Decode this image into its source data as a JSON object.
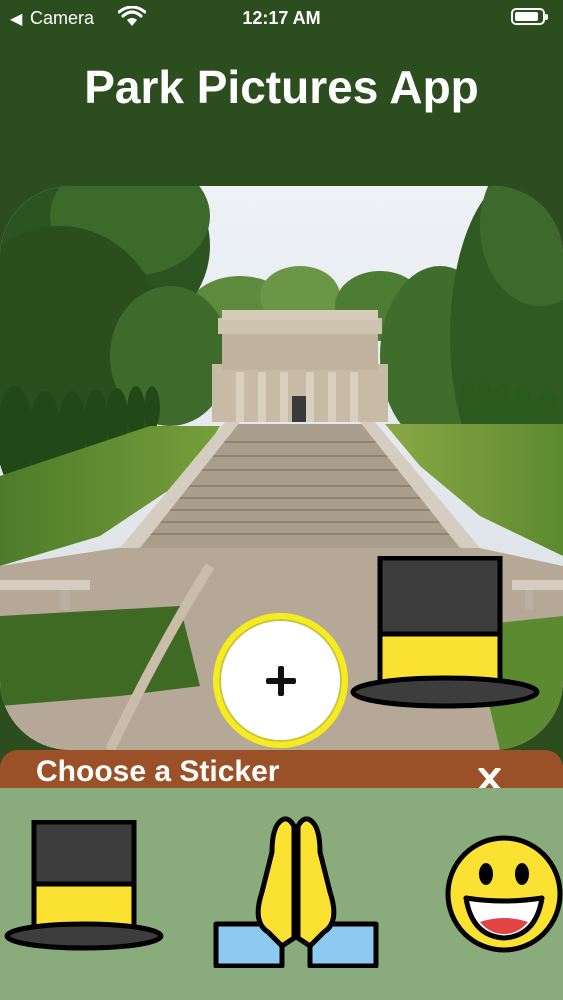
{
  "status_bar": {
    "back_label": "Camera",
    "time": "12:17 AM"
  },
  "header": {
    "title": "Park Pictures App"
  },
  "photo": {
    "subject": "memorial-building-with-steps"
  },
  "placed_stickers": [
    {
      "icon": "top-hat-icon"
    }
  ],
  "add_button": {
    "icon": "plus-icon"
  },
  "sticker_panel": {
    "title": "Choose a Sticker",
    "close_icon": "close-icon",
    "stickers": [
      {
        "icon": "top-hat-icon"
      },
      {
        "icon": "folded-hands-icon"
      },
      {
        "icon": "grinning-face-icon"
      }
    ]
  },
  "colors": {
    "background": "#2c4e1f",
    "panel_header": "#9a5127",
    "tray": "#8aab7c",
    "button_ring": "#f4ec1c"
  }
}
